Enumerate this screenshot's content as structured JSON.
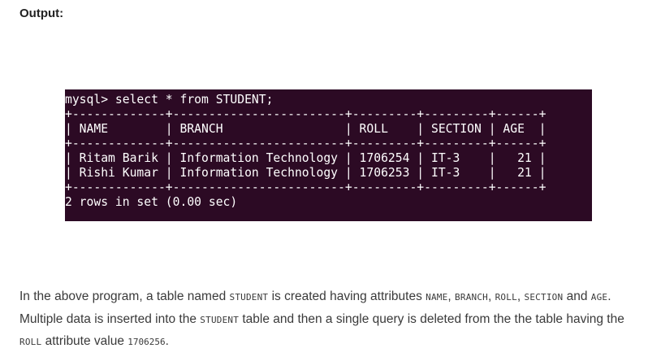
{
  "heading": "Output:",
  "terminal": {
    "lines": [
      "mysql> select * from STUDENT;",
      "+-------------+------------------------+---------+---------+------+",
      "| NAME        | BRANCH                 | ROLL    | SECTION | AGE  |",
      "+-------------+------------------------+---------+---------+------+",
      "| Ritam Barik | Information Technology | 1706254 | IT-3    |   21 |",
      "| Rishi Kumar | Information Technology | 1706253 | IT-3    |   21 |",
      "+-------------+------------------------+---------+---------+------+",
      "2 rows in set (0.00 sec)"
    ]
  },
  "description": {
    "t1": "In the above program, a table named ",
    "table_name_1": "STUDENT",
    "t2": " is created having attributes ",
    "attr_name": "NAME",
    "sep1": ", ",
    "attr_branch": "BRANCH",
    "sep2": ", ",
    "attr_roll": "ROLL",
    "sep3": ", ",
    "attr_section": "SECTION",
    "t3": " and ",
    "attr_age": "AGE",
    "t4": ". Multiple data is inserted into the ",
    "table_name_2": "STUDENT",
    "t5": " table and then a single query is deleted from the the table having the ",
    "attr_roll_2": "ROLL",
    "t6": " attribute value ",
    "roll_value": "1706256",
    "t7": "."
  },
  "colors": {
    "terminal_background": "#2c0a24",
    "terminal_text": "#ffffff",
    "body_text": "#3a3a3a"
  }
}
